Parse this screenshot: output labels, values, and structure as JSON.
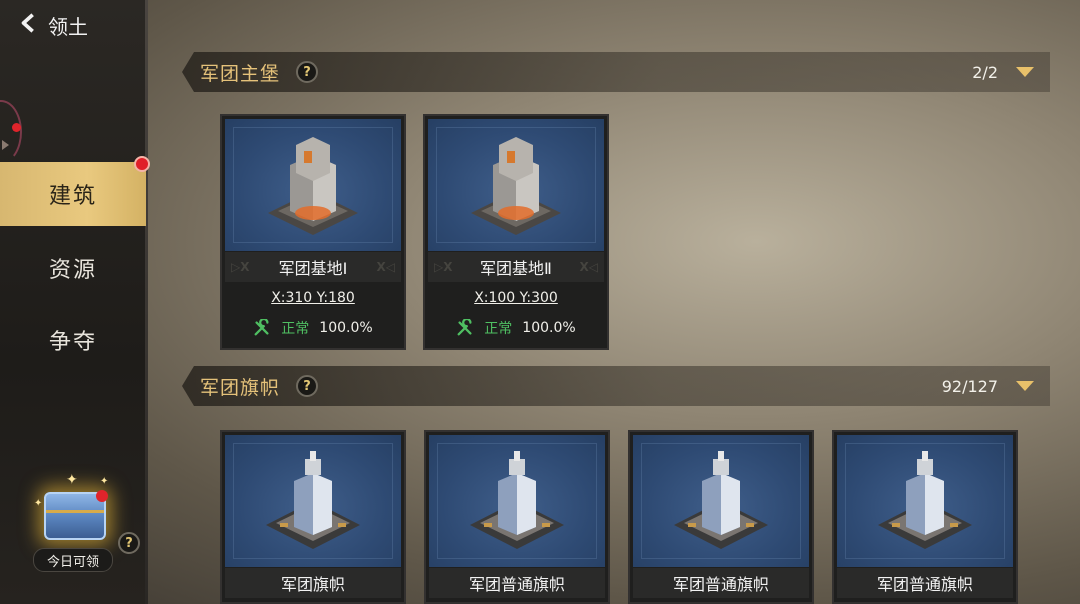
{
  "header": {
    "title": "领土"
  },
  "sidebar": {
    "items": [
      {
        "label": "建筑",
        "active": true
      },
      {
        "label": "资源",
        "active": false
      },
      {
        "label": "争夺",
        "active": false
      }
    ],
    "daily_reward_label": "今日可领",
    "help_symbol": "?"
  },
  "sections": [
    {
      "title": "军团主堡",
      "help_symbol": "?",
      "count": "2/2",
      "cards": [
        {
          "name": "军团基地Ⅰ",
          "coords": "X:310  Y:180",
          "status": "正常",
          "percent": "100.0%"
        },
        {
          "name": "军团基地Ⅱ",
          "coords": "X:100  Y:300",
          "status": "正常",
          "percent": "100.0%"
        }
      ]
    },
    {
      "title": "军团旗帜",
      "help_symbol": "?",
      "count": "92/127",
      "cards": [
        {
          "name": "军团旗帜"
        },
        {
          "name": "军团普通旗帜"
        },
        {
          "name": "军团普通旗帜"
        },
        {
          "name": "军团普通旗帜"
        }
      ]
    }
  ],
  "colors": {
    "accent": "#e5c27a",
    "active_tab": "#e0c075",
    "status_ok": "#4fbf62",
    "badge_red": "#e02028"
  }
}
